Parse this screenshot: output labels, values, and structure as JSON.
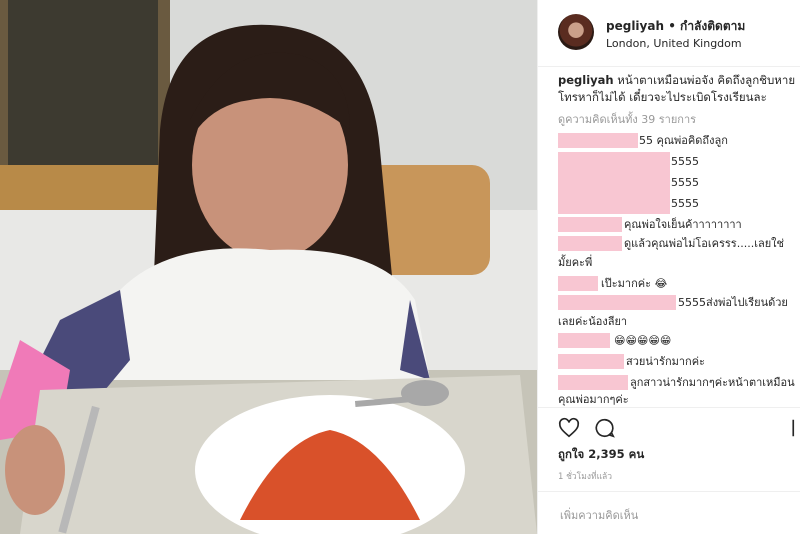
{
  "post": {
    "username": "pegliyah",
    "follow_label": "• กำลังติดตาม",
    "location": "London, United Kingdom",
    "caption_user": "pegliyah",
    "caption_text": " หน้าตาเหมือนพ่อจัง คิดถึงลูกชิบหายโทรหาก็ไม่ได้ เดี๋ยวจะไประเบิดโรงเรียนละ",
    "view_all_comments": "ดูความคิดเห็นทั้ง 39 รายการ",
    "likes": "ถูกใจ 2,395 คน",
    "time_ago": "1 ชั่วโมงที่แล้ว",
    "add_comment_placeholder": "เพิ่มความคิดเห็น"
  },
  "comments": [
    {
      "text": "55 คุณพ่อคิดถึงลูก"
    },
    {
      "text": "5555"
    },
    {
      "text": "5555"
    },
    {
      "text": "5555"
    },
    {
      "text": "คุณพ่อใจเย็นค้าาาาาาาา"
    },
    {
      "text": "ดูแล้วคุณพ่อไม่โอเครรร.....เลยใช่"
    },
    {
      "text": "มั้ยคะพี่"
    },
    {
      "text": "เป๊ะมากค่ะ 😂"
    },
    {
      "text": "5555ส่งพ่อไปเรียนด้วย"
    },
    {
      "text": "เลยค่ะน้องลียา"
    },
    {
      "text": "😁😁😁😁😁"
    },
    {
      "text": "สวยน่ารักมากค่ะ"
    },
    {
      "text": "ลูกสาวน่ารักมากๆค่ะหน้าตาเหมือน"
    },
    {
      "text": "คุณพ่อมากๆค่ะ"
    }
  ],
  "icons": {
    "heart": "heart-icon",
    "comment": "comment-icon",
    "bookmark": "bookmark-icon"
  },
  "colors": {
    "censor_pink": "#f8c6d2",
    "text": "#262626",
    "muted": "#999999"
  }
}
